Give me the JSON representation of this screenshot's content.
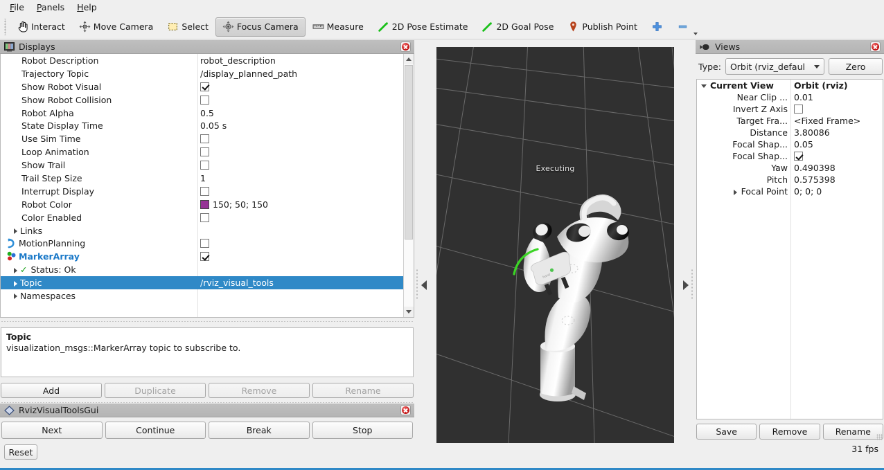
{
  "menu": {
    "items": [
      {
        "label": "File",
        "mnemonic": "F"
      },
      {
        "label": "Panels",
        "mnemonic": "P"
      },
      {
        "label": "Help",
        "mnemonic": "H"
      }
    ]
  },
  "toolbar": {
    "items": [
      {
        "label": "Interact",
        "icon": "hand-cursor-icon",
        "checked": false
      },
      {
        "label": "Move Camera",
        "icon": "move-camera-icon",
        "checked": false
      },
      {
        "label": "Select",
        "icon": "select-rectangle-icon",
        "checked": false
      },
      {
        "label": "Focus Camera",
        "icon": "focus-camera-icon",
        "checked": true
      },
      {
        "label": "Measure",
        "icon": "ruler-icon",
        "checked": false
      },
      {
        "label": "2D Pose Estimate",
        "icon": "green-arrow-icon",
        "checked": false
      },
      {
        "label": "2D Goal Pose",
        "icon": "green-arrow-icon",
        "checked": false
      },
      {
        "label": "Publish Point",
        "icon": "map-pin-icon",
        "checked": false
      },
      {
        "label": "",
        "icon": "plus-icon",
        "checked": false
      },
      {
        "label": "",
        "icon": "minus-icon",
        "checked": false
      }
    ]
  },
  "displays": {
    "title": "Displays",
    "rows": [
      {
        "name": "Robot Description",
        "indent": 30,
        "arrow": "",
        "icon": "",
        "value_type": "text",
        "value": "robot_description"
      },
      {
        "name": "Trajectory Topic",
        "indent": 30,
        "arrow": "",
        "icon": "",
        "value_type": "text",
        "value": "/display_planned_path"
      },
      {
        "name": "Show Robot Visual",
        "indent": 30,
        "arrow": "",
        "icon": "",
        "value_type": "check",
        "checked": true
      },
      {
        "name": "Show Robot Collision",
        "indent": 30,
        "arrow": "",
        "icon": "",
        "value_type": "check",
        "checked": false
      },
      {
        "name": "Robot Alpha",
        "indent": 30,
        "arrow": "",
        "icon": "",
        "value_type": "text",
        "value": "0.5"
      },
      {
        "name": "State Display Time",
        "indent": 30,
        "arrow": "",
        "icon": "",
        "value_type": "text",
        "value": "0.05 s"
      },
      {
        "name": "Use Sim Time",
        "indent": 30,
        "arrow": "",
        "icon": "",
        "value_type": "check",
        "checked": false
      },
      {
        "name": "Loop Animation",
        "indent": 30,
        "arrow": "",
        "icon": "",
        "value_type": "check",
        "checked": false
      },
      {
        "name": "Show Trail",
        "indent": 30,
        "arrow": "",
        "icon": "",
        "value_type": "check",
        "checked": false
      },
      {
        "name": "Trail Step Size",
        "indent": 30,
        "arrow": "",
        "icon": "",
        "value_type": "text",
        "value": "1"
      },
      {
        "name": "Interrupt Display",
        "indent": 30,
        "arrow": "",
        "icon": "",
        "value_type": "check",
        "checked": false
      },
      {
        "name": "Robot Color",
        "indent": 30,
        "arrow": "",
        "icon": "",
        "value_type": "color",
        "value": "150; 50; 150",
        "color": "#963296"
      },
      {
        "name": "Color Enabled",
        "indent": 30,
        "arrow": "",
        "icon": "",
        "value_type": "check",
        "checked": false
      },
      {
        "name": "Links",
        "indent": 15,
        "arrow": "right",
        "icon": "",
        "value_type": "none"
      },
      {
        "name": "MotionPlanning",
        "indent": 8,
        "arrow": "",
        "icon": "motionplanning-icon",
        "value_type": "check",
        "checked": false
      },
      {
        "name": "MarkerArray",
        "indent": 8,
        "arrow": "",
        "icon": "markerarray-icon",
        "value_type": "check",
        "checked": true,
        "style": "bold-blue"
      },
      {
        "name": "Status: Ok",
        "indent": 15,
        "arrow": "right",
        "icon": "check-ok-icon",
        "value_type": "none"
      },
      {
        "name": "Topic",
        "indent": 15,
        "arrow": "right",
        "icon": "",
        "value_type": "text",
        "value": "/rviz_visual_tools",
        "selected": true
      },
      {
        "name": "Namespaces",
        "indent": 15,
        "arrow": "right",
        "icon": "",
        "value_type": "none"
      }
    ],
    "description": {
      "title": "Topic",
      "body": "visualization_msgs::MarkerArray topic to subscribe to."
    },
    "buttons": [
      {
        "label": "Add",
        "disabled": false
      },
      {
        "label": "Duplicate",
        "disabled": true
      },
      {
        "label": "Remove",
        "disabled": true
      },
      {
        "label": "Rename",
        "disabled": true
      }
    ]
  },
  "rviz_visual_tools": {
    "title": "RvizVisualToolsGui",
    "buttons": [
      {
        "label": "Next"
      },
      {
        "label": "Continue"
      },
      {
        "label": "Break"
      },
      {
        "label": "Stop"
      }
    ],
    "reset_label": "Reset"
  },
  "viewport": {
    "status_text": "Executing",
    "background_color": "#303030",
    "grid_color": "#8c8c8c",
    "trajectory_arc_color": "#3bd425"
  },
  "views": {
    "title": "Views",
    "type_label": "Type:",
    "type_value": "Orbit (rviz_defaul",
    "zero_label": "Zero",
    "rows": [
      {
        "name": "Current View",
        "arrow": "down",
        "lead": true,
        "bold": true,
        "value_type": "text",
        "value": "Orbit (rviz)"
      },
      {
        "name": "Near Clip ...",
        "arrow": "",
        "lead": false,
        "bold": false,
        "value_type": "text",
        "value": "0.01"
      },
      {
        "name": "Invert Z Axis",
        "arrow": "",
        "lead": false,
        "bold": false,
        "value_type": "check",
        "checked": false
      },
      {
        "name": "Target Fra...",
        "arrow": "",
        "lead": false,
        "bold": false,
        "value_type": "text",
        "value": "<Fixed Frame>"
      },
      {
        "name": "Distance",
        "arrow": "",
        "lead": false,
        "bold": false,
        "value_type": "text",
        "value": "3.80086"
      },
      {
        "name": "Focal Shap...",
        "arrow": "",
        "lead": false,
        "bold": false,
        "value_type": "text",
        "value": "0.05"
      },
      {
        "name": "Focal Shap...",
        "arrow": "",
        "lead": false,
        "bold": false,
        "value_type": "check",
        "checked": true
      },
      {
        "name": "Yaw",
        "arrow": "",
        "lead": false,
        "bold": false,
        "value_type": "text",
        "value": "0.490398"
      },
      {
        "name": "Pitch",
        "arrow": "",
        "lead": false,
        "bold": false,
        "value_type": "text",
        "value": "0.575398"
      },
      {
        "name": "Focal Point",
        "arrow": "right",
        "lead": false,
        "bold": false,
        "value_type": "text",
        "value": "0; 0; 0"
      }
    ],
    "buttons": [
      {
        "label": "Save"
      },
      {
        "label": "Remove"
      },
      {
        "label": "Rename"
      }
    ],
    "fps": "31 fps"
  },
  "colors": {
    "selection_blue": "#2f89c7",
    "marker_blue": "#1b79c8",
    "robot_color": "#963296"
  }
}
